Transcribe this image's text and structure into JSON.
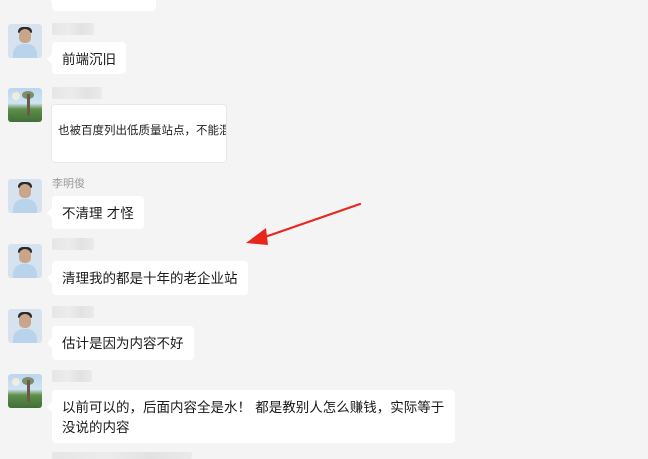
{
  "messages": [
    {
      "type": "text",
      "text": "前端沉旧"
    },
    {
      "type": "card",
      "text": "也被百度列出低质量站点，不能混"
    },
    {
      "type": "text",
      "sender": "李明俊",
      "text": "不清理 才怪"
    },
    {
      "type": "text",
      "text": "清理我的都是十年的老企业站"
    },
    {
      "type": "text",
      "text": "估计是因为内容不好"
    },
    {
      "type": "text",
      "text": "以前可以的，后面内容全是水！ 都是教别人怎么赚钱，实际等于没说的内容"
    }
  ],
  "annotation": {
    "color": "#e8261c",
    "icon": "red-arrow-pointer"
  },
  "colors": {
    "background": "#f4f4f4",
    "bubble": "#ffffff",
    "sender_name": "#9a9a9a"
  }
}
